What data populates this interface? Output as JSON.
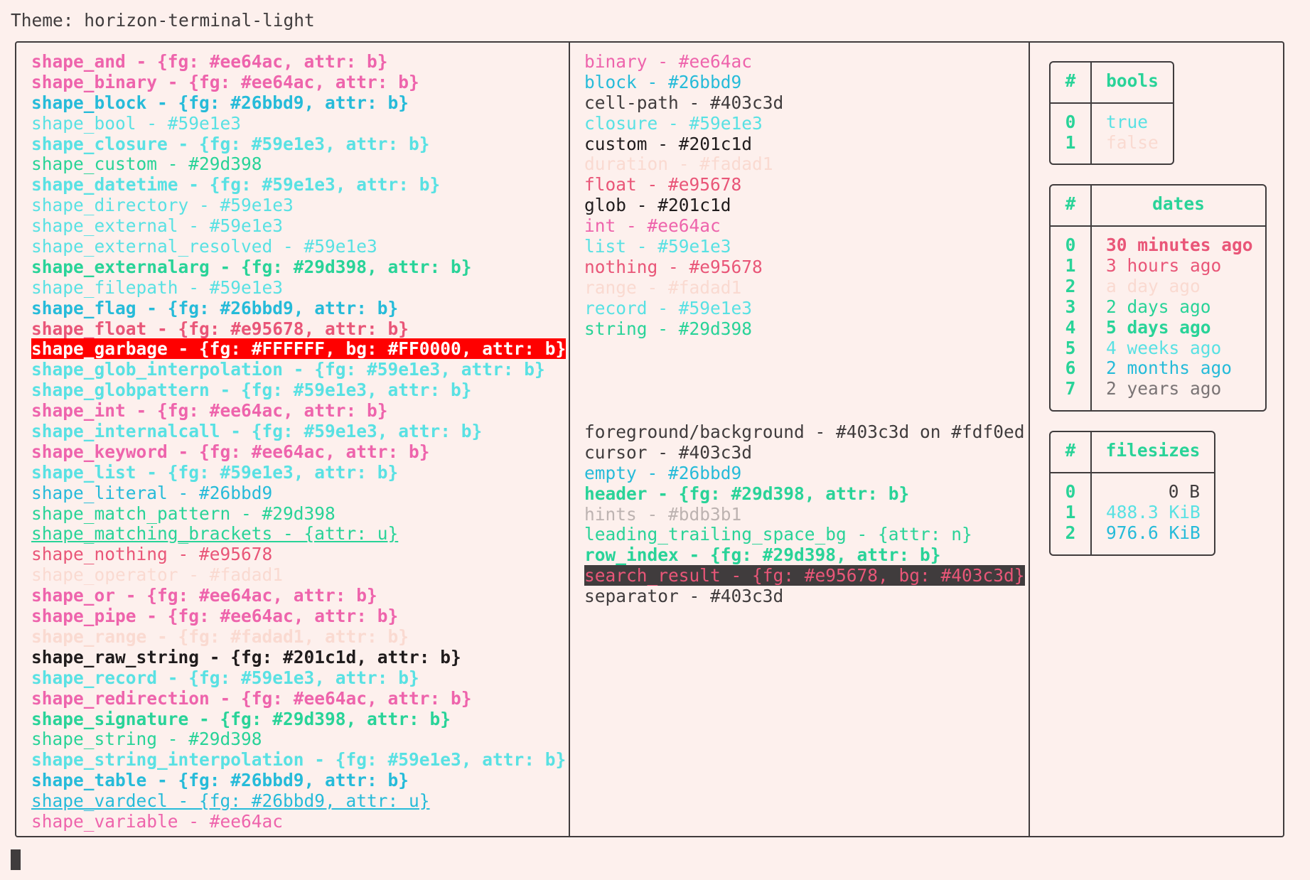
{
  "theme_label": "Theme: horizon-terminal-light",
  "colors": {
    "background": "#fdf0ed",
    "foreground": "#403c3d"
  },
  "left_column": [
    {
      "text": "shape_and - {fg: #ee64ac, attr: b}",
      "color": "#ee64ac",
      "bold": true
    },
    {
      "text": "shape_binary - {fg: #ee64ac, attr: b}",
      "color": "#ee64ac",
      "bold": true
    },
    {
      "text": "shape_block - {fg: #26bbd9, attr: b}",
      "color": "#26bbd9",
      "bold": true
    },
    {
      "text": "shape_bool - #59e1e3",
      "color": "#59e1e3"
    },
    {
      "text": "shape_closure - {fg: #59e1e3, attr: b}",
      "color": "#59e1e3",
      "bold": true
    },
    {
      "text": "shape_custom - #29d398",
      "color": "#29d398"
    },
    {
      "text": "shape_datetime - {fg: #59e1e3, attr: b}",
      "color": "#59e1e3",
      "bold": true
    },
    {
      "text": "shape_directory - #59e1e3",
      "color": "#59e1e3"
    },
    {
      "text": "shape_external - #59e1e3",
      "color": "#59e1e3"
    },
    {
      "text": "shape_external_resolved - #59e1e3",
      "color": "#59e1e3"
    },
    {
      "text": "shape_externalarg - {fg: #29d398, attr: b}",
      "color": "#29d398",
      "bold": true
    },
    {
      "text": "shape_filepath - #59e1e3",
      "color": "#59e1e3"
    },
    {
      "text": "shape_flag - {fg: #26bbd9, attr: b}",
      "color": "#26bbd9",
      "bold": true
    },
    {
      "text": "shape_float - {fg: #e95678, attr: b}",
      "color": "#e95678",
      "bold": true
    },
    {
      "text": "shape_garbage - {fg: #FFFFFF, bg: #FF0000, attr: b}",
      "color": "#FFFFFF",
      "bg": "#FF0000",
      "bold": true
    },
    {
      "text": "shape_glob_interpolation - {fg: #59e1e3, attr: b}",
      "color": "#59e1e3",
      "bold": true
    },
    {
      "text": "shape_globpattern - {fg: #59e1e3, attr: b}",
      "color": "#59e1e3",
      "bold": true
    },
    {
      "text": "shape_int - {fg: #ee64ac, attr: b}",
      "color": "#ee64ac",
      "bold": true
    },
    {
      "text": "shape_internalcall - {fg: #59e1e3, attr: b}",
      "color": "#59e1e3",
      "bold": true
    },
    {
      "text": "shape_keyword - {fg: #ee64ac, attr: b}",
      "color": "#ee64ac",
      "bold": true
    },
    {
      "text": "shape_list - {fg: #59e1e3, attr: b}",
      "color": "#59e1e3",
      "bold": true
    },
    {
      "text": "shape_literal - #26bbd9",
      "color": "#26bbd9"
    },
    {
      "text": "shape_match_pattern - #29d398",
      "color": "#29d398"
    },
    {
      "text": "shape_matching_brackets - {attr: u}",
      "color": "#29d398",
      "underline": true
    },
    {
      "text": "shape_nothing - #e95678",
      "color": "#e95678"
    },
    {
      "text": "shape_operator - #fadad1",
      "color": "#fadad1"
    },
    {
      "text": "shape_or - {fg: #ee64ac, attr: b}",
      "color": "#ee64ac",
      "bold": true
    },
    {
      "text": "shape_pipe - {fg: #ee64ac, attr: b}",
      "color": "#ee64ac",
      "bold": true
    },
    {
      "text": "shape_range - {fg: #fadad1, attr: b}",
      "color": "#fadad1",
      "bold": true
    },
    {
      "text": "shape_raw_string - {fg: #201c1d, attr: b}",
      "color": "#201c1d",
      "bold": true
    },
    {
      "text": "shape_record - {fg: #59e1e3, attr: b}",
      "color": "#59e1e3",
      "bold": true
    },
    {
      "text": "shape_redirection - {fg: #ee64ac, attr: b}",
      "color": "#ee64ac",
      "bold": true
    },
    {
      "text": "shape_signature - {fg: #29d398, attr: b}",
      "color": "#29d398",
      "bold": true
    },
    {
      "text": "shape_string - #29d398",
      "color": "#29d398"
    },
    {
      "text": "shape_string_interpolation - {fg: #59e1e3, attr: b}",
      "color": "#59e1e3",
      "bold": true
    },
    {
      "text": "shape_table - {fg: #26bbd9, attr: b}",
      "color": "#26bbd9",
      "bold": true
    },
    {
      "text": "shape_vardecl - {fg: #26bbd9, attr: u}",
      "color": "#26bbd9",
      "underline": true
    },
    {
      "text": "shape_variable - #ee64ac",
      "color": "#ee64ac"
    }
  ],
  "middle_top": [
    {
      "text": "binary - #ee64ac",
      "color": "#ee64ac"
    },
    {
      "text": "block - #26bbd9",
      "color": "#26bbd9"
    },
    {
      "text": "cell-path - #403c3d",
      "color": "#403c3d"
    },
    {
      "text": "closure - #59e1e3",
      "color": "#59e1e3"
    },
    {
      "text": "custom - #201c1d",
      "color": "#201c1d"
    },
    {
      "text": "duration - #fadad1",
      "color": "#fadad1"
    },
    {
      "text": "float - #e95678",
      "color": "#e95678"
    },
    {
      "text": "glob - #201c1d",
      "color": "#201c1d"
    },
    {
      "text": "int - #ee64ac",
      "color": "#ee64ac"
    },
    {
      "text": "list - #59e1e3",
      "color": "#59e1e3"
    },
    {
      "text": "nothing - #e95678",
      "color": "#e95678"
    },
    {
      "text": "range - #fadad1",
      "color": "#fadad1"
    },
    {
      "text": "record - #59e1e3",
      "color": "#59e1e3"
    },
    {
      "text": "string - #29d398",
      "color": "#29d398"
    }
  ],
  "middle_bottom": [
    {
      "text": "foreground/background - #403c3d on #fdf0ed",
      "color": "#403c3d"
    },
    {
      "text": "cursor - #403c3d",
      "color": "#403c3d"
    },
    {
      "text": "empty - #26bbd9",
      "color": "#26bbd9"
    },
    {
      "text": "header - {fg: #29d398, attr: b}",
      "color": "#29d398",
      "bold": true
    },
    {
      "text": "hints - #bdb3b1",
      "color": "#bdb3b1"
    },
    {
      "text": "leading_trailing_space_bg - {attr: n}",
      "color": "#29d398"
    },
    {
      "text": "row_index - {fg: #29d398, attr: b}",
      "color": "#29d398",
      "bold": true
    },
    {
      "text": "search_result - {fg: #e95678, bg: #403c3d}",
      "color": "#e95678",
      "bg": "#403c3d"
    },
    {
      "text": "separator - #403c3d",
      "color": "#403c3d"
    }
  ],
  "tables": [
    {
      "index_header": "#",
      "header": "bools",
      "rows": [
        {
          "index": "0",
          "value": "true",
          "color": "#59e1e3"
        },
        {
          "index": "1",
          "value": "false",
          "color": "#fadad1"
        }
      ]
    },
    {
      "index_header": "#",
      "header": "dates",
      "rows": [
        {
          "index": "0",
          "value": "30 minutes ago",
          "color": "#e95678",
          "bold": true
        },
        {
          "index": "1",
          "value": "3 hours ago",
          "color": "#e95678"
        },
        {
          "index": "2",
          "value": "a day ago",
          "color": "#fadad1"
        },
        {
          "index": "3",
          "value": "2 days ago",
          "color": "#29d398"
        },
        {
          "index": "4",
          "value": "5 days ago",
          "color": "#29d398",
          "bold": true
        },
        {
          "index": "5",
          "value": "4 weeks ago",
          "color": "#59e1e3"
        },
        {
          "index": "6",
          "value": "2 months ago",
          "color": "#26bbd9"
        },
        {
          "index": "7",
          "value": "2 years ago",
          "color": "#7a7475"
        }
      ]
    },
    {
      "index_header": "#",
      "header": "filesizes",
      "rows": [
        {
          "index": "0",
          "value": "0 B",
          "color": "#403c3d",
          "align": "right"
        },
        {
          "index": "1",
          "value": "488.3 KiB",
          "color": "#59e1e3",
          "align": "right"
        },
        {
          "index": "2",
          "value": "976.6 KiB",
          "color": "#26bbd9",
          "align": "right"
        }
      ]
    }
  ]
}
